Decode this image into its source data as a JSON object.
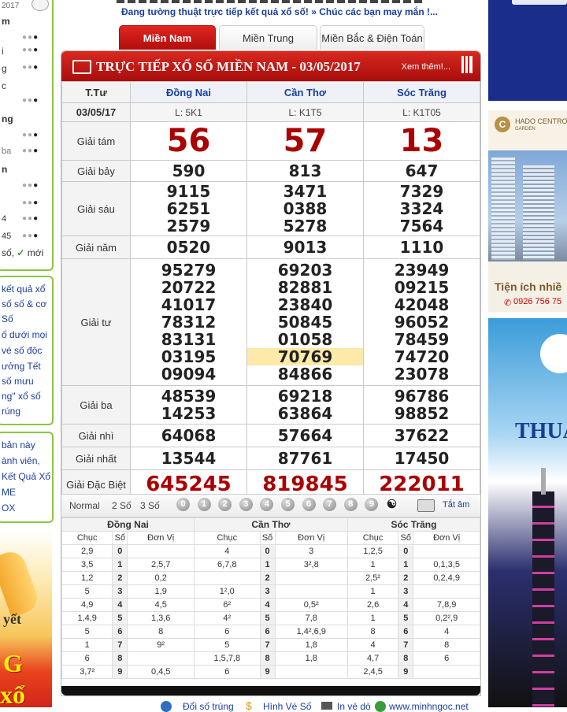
{
  "top": {
    "marquee": "Đang tường thuật trực tiếp kết quả xổ số! » Chúc các bạn may mắn !...",
    "tabs": [
      "Miền Nam",
      "Miền Trung",
      "Miền Bắc & Điện Toán"
    ]
  },
  "left": {
    "date_fragment": "2017",
    "letters": [
      "m",
      "i",
      "g",
      "c",
      "ng",
      "ba",
      "n",
      "4",
      "45"
    ],
    "footer_pre": "số,",
    "footer_check": "✓",
    "footer_post": "mới",
    "links1": [
      "kết quả xổ",
      "số số & cơ",
      "Số",
      "ố dưới mọi",
      "vé số độc",
      "ưởng Tết",
      "số mưu",
      "ng\" xổ số",
      "rúng"
    ],
    "links2": [
      "bản này",
      "ành viên,",
      "Kết Quả Xổ",
      "ME",
      "OX"
    ],
    "banner_text1": "yết",
    "banner_text2": "G",
    "banner_text3": "xổ"
  },
  "ads": {
    "ad2_brand": "HADO CENTROSA",
    "ad2_sub": "GARDEN",
    "ad2_tagline": "Tiện ích nhiề",
    "ad2_phone": "0926 756 75",
    "ad3_text": "THUẬN"
  },
  "panel": {
    "title": "TRỰC TIẾP XỔ SỐ MIỀN NAM - 03/05/2017",
    "more": "Xem thêm!...",
    "header_day": "T.Tư",
    "date": "03/05/17",
    "provinces": [
      "Đồng Nai",
      "Cần Thơ",
      "Sóc Trăng"
    ],
    "codes": [
      "L: 5K1",
      "L: K1T5",
      "L: K1T05"
    ],
    "prizes": [
      {
        "label": "Giải tám",
        "type": "big",
        "values": [
          [
            "56"
          ],
          [
            "57"
          ],
          [
            "13"
          ]
        ]
      },
      {
        "label": "Giải bảy",
        "values": [
          [
            "590"
          ],
          [
            "813"
          ],
          [
            "647"
          ]
        ]
      },
      {
        "label": "Giải sáu",
        "values": [
          [
            "9115",
            "6251",
            "2579"
          ],
          [
            "3471",
            "0388",
            "5278"
          ],
          [
            "7329",
            "3324",
            "7564"
          ]
        ]
      },
      {
        "label": "Giải năm",
        "values": [
          [
            "0520"
          ],
          [
            "9013"
          ],
          [
            "1110"
          ]
        ]
      },
      {
        "label": "Giải tư",
        "values": [
          [
            "95279",
            "20722",
            "41017",
            "78312",
            "83131",
            "03195",
            "09094"
          ],
          [
            "69203",
            "82881",
            "23840",
            "50845",
            "01058",
            "70769",
            "84866"
          ],
          [
            "23949",
            "09215",
            "42048",
            "96052",
            "78459",
            "74720",
            "23078"
          ]
        ]
      },
      {
        "label": "Giải ba",
        "values": [
          [
            "48539",
            "14253"
          ],
          [
            "69218",
            "63864"
          ],
          [
            "96786",
            "98852"
          ]
        ]
      },
      {
        "label": "Giải nhì",
        "values": [
          [
            "64068"
          ],
          [
            "57664"
          ],
          [
            "37622"
          ]
        ]
      },
      {
        "label": "Giải nhất",
        "values": [
          [
            "13544"
          ],
          [
            "87761"
          ],
          [
            "17450"
          ]
        ]
      },
      {
        "label": "Giải Đặc Biệt",
        "type": "special",
        "values": [
          [
            "645245"
          ],
          [
            "819845"
          ],
          [
            "222011"
          ]
        ]
      }
    ],
    "toolbar": {
      "normal": "Normal",
      "two": "2 Số",
      "three": "3 Số",
      "digits": [
        "0",
        "1",
        "2",
        "3",
        "4",
        "5",
        "6",
        "7",
        "8",
        "9"
      ],
      "yin": "☯",
      "sound_off": "Tắt âm"
    },
    "loto": {
      "provinces": [
        "Đồng Nai",
        "Cần Thơ",
        "Sóc Trăng"
      ],
      "col_chuc": "Chục",
      "col_so": "Số",
      "col_donvi": "Đơn Vị",
      "rows": [
        [
          [
            "2,9",
            "0",
            ""
          ],
          [
            "4",
            "0",
            "3"
          ],
          [
            "1,2,5",
            "0",
            ""
          ]
        ],
        [
          [
            "3,5",
            "1",
            "2,5,7"
          ],
          [
            "6,7,8",
            "1",
            "3²,8"
          ],
          [
            "1",
            "1",
            "0,1,3,5"
          ]
        ],
        [
          [
            "1,2",
            "2",
            "0,2"
          ],
          [
            "",
            "2",
            ""
          ],
          [
            "2,5²",
            "2",
            "0,2,4,9"
          ]
        ],
        [
          [
            "5",
            "3",
            "1,9"
          ],
          [
            "1²,0",
            "3",
            ""
          ],
          [
            "1",
            "3",
            ""
          ]
        ],
        [
          [
            "4,9",
            "4",
            "4,5"
          ],
          [
            "6²",
            "4",
            "0,5²"
          ],
          [
            "2,6",
            "4",
            "7,8,9"
          ]
        ],
        [
          [
            "1,4,9",
            "5",
            "1,3,6"
          ],
          [
            "4²",
            "5",
            "7,8"
          ],
          [
            "1",
            "5",
            "0,2²,9"
          ]
        ],
        [
          [
            "5",
            "6",
            "8"
          ],
          [
            "6",
            "6",
            "1,4²,6,9"
          ],
          [
            "8",
            "6",
            "4"
          ]
        ],
        [
          [
            "1",
            "7",
            "9²"
          ],
          [
            "5",
            "7",
            "1,8"
          ],
          [
            "4",
            "7",
            "8"
          ]
        ],
        [
          [
            "6",
            "8",
            ""
          ],
          [
            "1,5,7,8",
            "8",
            "1,8"
          ],
          [
            "4,7",
            "8",
            "6"
          ]
        ],
        [
          [
            "3,7²",
            "9",
            "0,4,5"
          ],
          [
            "6",
            "9",
            ""
          ],
          [
            "2,4,5",
            "9",
            ""
          ]
        ]
      ]
    }
  },
  "footer": {
    "link1": "Đổi số trúng",
    "link2": "Hình Vé Số",
    "link3": "In vé dò",
    "link4": "www.minhngoc.net"
  },
  "colors": {
    "accent_red": "#c21a14",
    "link_blue": "#1a3e9e",
    "highlight": "#fde9a8",
    "green_border": "#8cc63f"
  }
}
